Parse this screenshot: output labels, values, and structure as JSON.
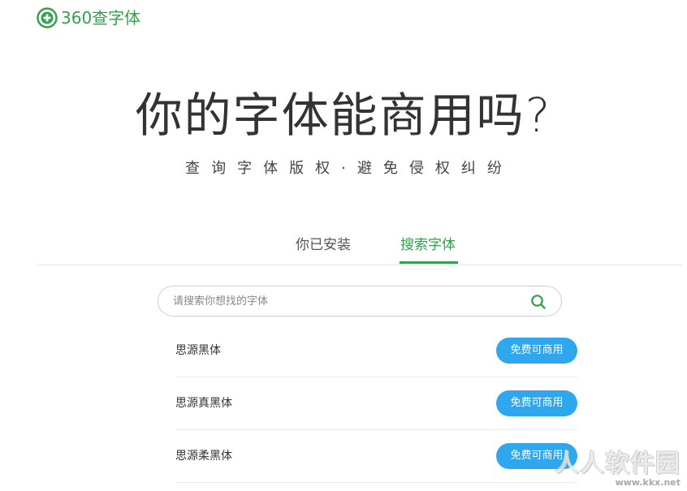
{
  "brand": {
    "logo_text": "360查字体",
    "accent_color": "#33a04a",
    "logo_icon": "plus-circle-icon"
  },
  "hero": {
    "title": "你的字体能商用吗?",
    "subtitle": "查询字体版权·避免侵权纠纷"
  },
  "tabs": [
    {
      "label": "你已安装",
      "active": false
    },
    {
      "label": "搜索字体",
      "active": true
    }
  ],
  "search": {
    "placeholder": "请搜索你想找的字体",
    "value": "",
    "icon": "search-icon"
  },
  "fonts": [
    {
      "name": "思源黑体",
      "license": "免费可商用"
    },
    {
      "name": "思源真黑体",
      "license": "免费可商用"
    },
    {
      "name": "思源柔黑体",
      "license": "免费可商用"
    }
  ],
  "badge_color": "#2ea7ee",
  "watermark": {
    "text": "人人软件园",
    "url": "www.kkx.net"
  }
}
